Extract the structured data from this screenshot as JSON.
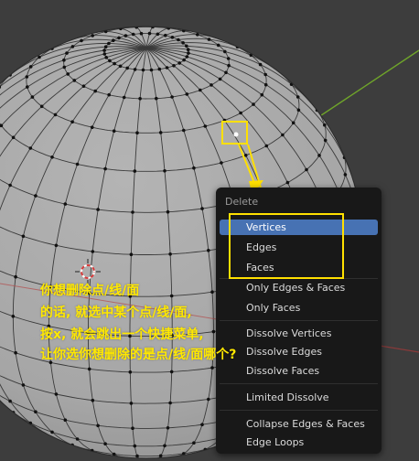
{
  "menu": {
    "title": "Delete",
    "items": [
      {
        "label": "Vertices",
        "active": true
      },
      {
        "label": "Edges"
      },
      {
        "label": "Faces"
      },
      {
        "label": "Only Edges & Faces"
      },
      {
        "label": "Only Faces"
      },
      {
        "label": "Dissolve Vertices"
      },
      {
        "label": "Dissolve Edges"
      },
      {
        "label": "Dissolve Faces"
      },
      {
        "label": "Limited Dissolve"
      },
      {
        "label": "Collapse Edges & Faces"
      },
      {
        "label": "Edge Loops"
      }
    ]
  },
  "annotation": {
    "lines": [
      "你想删除点/线/面",
      "的话, 就选中某个点/线/面,",
      "按x, 就会跳出一个快捷菜单,",
      "让你选你想删除的是点/线/面哪个?"
    ]
  },
  "colors": {
    "background": "#3d3d3d",
    "sphere": "#a8a8a8",
    "menu_bg": "#181818",
    "highlight": "#4772b3",
    "annotation": "#ffe800",
    "axis_green": "#6fa52a",
    "axis_red": "#b34a4a"
  },
  "icons": {
    "cursor": "3d-cursor-icon",
    "arrow": "arrow-icon"
  }
}
